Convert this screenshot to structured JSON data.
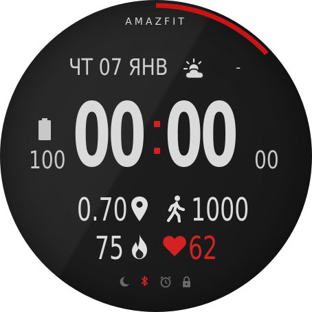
{
  "brand": "AMAZFIT",
  "date": "ЧТ 07 ЯНВ",
  "weather": {
    "icon": "partly-cloudy-icon",
    "temperature": "-"
  },
  "battery": {
    "icon": "battery-icon",
    "level": "100"
  },
  "time": {
    "hours": "00",
    "minutes": "00",
    "seconds": "00"
  },
  "metrics": {
    "distance": "0.70",
    "steps": "1000",
    "calories": "75",
    "heart_rate": "62"
  },
  "status_icons": [
    "moon-icon",
    "bluetooth-icon",
    "alarm-icon",
    "lock-icon"
  ],
  "colors": {
    "accent": "#d42222",
    "text": "#dcdcdc",
    "background": "#222222"
  }
}
